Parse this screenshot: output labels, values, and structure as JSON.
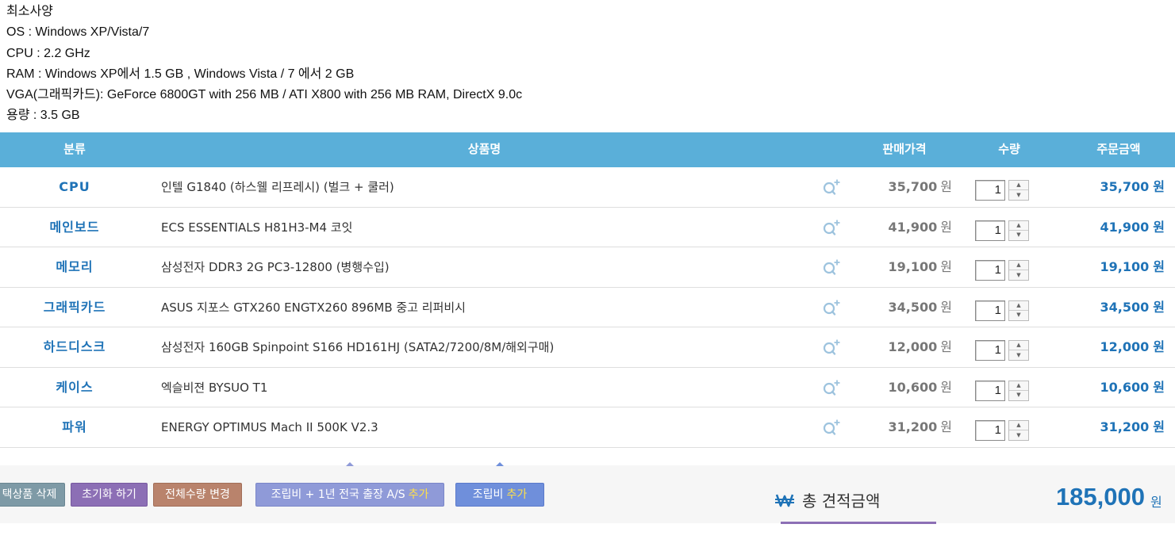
{
  "specs": {
    "lines": [
      "최소사양",
      "OS : Windows XP/Vista/7",
      "CPU : 2.2 GHz",
      "RAM : Windows XP에서 1.5 GB , Windows Vista / 7 에서 2 GB",
      "VGA(그래픽카드): GeForce 6800GT with 256 MB / ATI X800 with 256 MB RAM, DirectX 9.0c",
      "용량 : 3.5 GB"
    ]
  },
  "header": {
    "category": "분류",
    "product": "상품명",
    "price": "판매가격",
    "quantity": "수량",
    "order_amount": "주문금액"
  },
  "currency": "원",
  "rows": [
    {
      "category": "CPU",
      "product": "인텔 G1840 (하스웰 리프레시) (벌크 + 쿨러)",
      "price": "35,700",
      "qty": "1",
      "total": "35,700"
    },
    {
      "category": "메인보드",
      "product": "ECS ESSENTIALS H81H3-M4 코잇",
      "price": "41,900",
      "qty": "1",
      "total": "41,900"
    },
    {
      "category": "메모리",
      "product": "삼성전자 DDR3 2G PC3-12800 (병행수입)",
      "price": "19,100",
      "qty": "1",
      "total": "19,100"
    },
    {
      "category": "그래픽카드",
      "product": "ASUS 지포스 GTX260 ENGTX260 896MB 중고 리퍼비시",
      "price": "34,500",
      "qty": "1",
      "total": "34,500"
    },
    {
      "category": "하드디스크",
      "product": "삼성전자 160GB Spinpoint S166 HD161HJ (SATA2/7200/8M/해외구매)",
      "price": "12,000",
      "qty": "1",
      "total": "12,000"
    },
    {
      "category": "케이스",
      "product": "엑슬비젼 BYSUO T1",
      "price": "10,600",
      "qty": "1",
      "total": "10,600"
    },
    {
      "category": "파워",
      "product": "ENERGY OPTIMUS Mach II 500K V2.3",
      "price": "31,200",
      "qty": "1",
      "total": "31,200"
    }
  ],
  "footer": {
    "delete_label": "택상품 삭제",
    "reset_label": "초기화 하기",
    "change_qty_label": "전체수량 변경",
    "as_label": "조립비 + 1년 전국 출장 A/S",
    "as_highlight": "추가",
    "assembly_label": "조립비",
    "assembly_highlight": "추가",
    "total_label": "총 견적금액",
    "total_amount": "185,000",
    "total_unit": "원"
  },
  "colors": {
    "header_bg": "#5aafd9",
    "accent_blue": "#1f73b7",
    "btn_delete": "#7e9aa6",
    "btn_reset": "#8c6fb5",
    "btn_change": "#b9836c",
    "btn_as": "#8f9ad8",
    "btn_assembly": "#6f8fdb",
    "highlight": "#ffe04a"
  },
  "icons": {
    "zoom": "zoom-plus-icon",
    "spin_up": "arrow-up-icon",
    "spin_down": "arrow-down-icon",
    "won": "won-currency-icon"
  }
}
